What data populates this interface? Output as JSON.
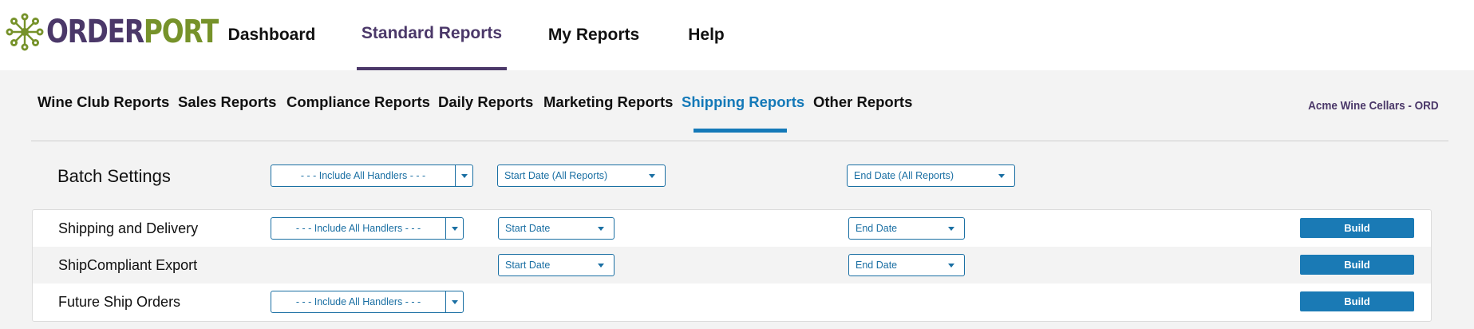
{
  "logo": {
    "part1": "ORDER",
    "part2": "PORT"
  },
  "main_nav": [
    {
      "label": "Dashboard",
      "active": false
    },
    {
      "label": "Standard Reports",
      "active": true
    },
    {
      "label": "My Reports",
      "active": false
    },
    {
      "label": "Help",
      "active": false
    }
  ],
  "sub_tabs": [
    {
      "label": "Wine Club Reports",
      "active": false
    },
    {
      "label": "Sales Reports",
      "active": false
    },
    {
      "label": "Compliance Reports",
      "active": false
    },
    {
      "label": "Daily Reports",
      "active": false
    },
    {
      "label": "Marketing Reports",
      "active": false
    },
    {
      "label": "Shipping Reports",
      "active": true
    },
    {
      "label": "Other Reports",
      "active": false
    }
  ],
  "account_name": "Acme Wine Cellars - ORD",
  "batch": {
    "label": "Batch Settings",
    "handler": "- - - Include All Handlers - - -",
    "start_date": "Start Date (All Reports)",
    "end_date": "End Date (All Reports)"
  },
  "reports": [
    {
      "name": "Shipping and Delivery",
      "handler": "- - - Include All Handlers - - -",
      "start_date": "Start Date",
      "end_date": "End Date",
      "build_label": "Build"
    },
    {
      "name": "ShipCompliant Export",
      "start_date": "Start Date",
      "end_date": "End Date",
      "build_label": "Build"
    },
    {
      "name": "Future Ship Orders",
      "handler": "- - - Include All Handlers - - -",
      "build_label": "Build"
    }
  ],
  "colors": {
    "purple": "#4b3869",
    "green": "#76922a",
    "blue": "#1479b8"
  }
}
